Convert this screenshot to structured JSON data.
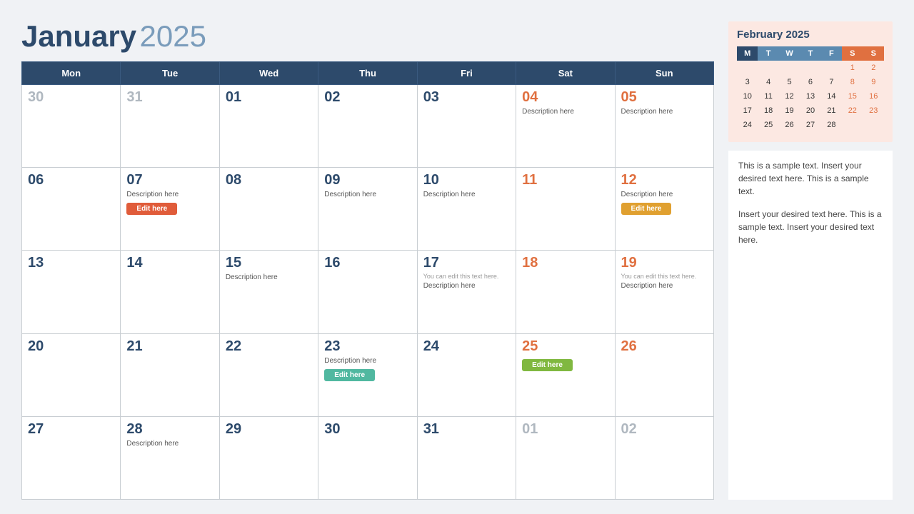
{
  "header": {
    "month": "January",
    "year": "2025"
  },
  "weekdays": [
    "Mon",
    "Tue",
    "Wed",
    "Thu",
    "Fri",
    "Sat",
    "Sun"
  ],
  "weeks": [
    [
      {
        "num": "30",
        "inactive": true
      },
      {
        "num": "31",
        "inactive": true
      },
      {
        "num": "01"
      },
      {
        "num": "02"
      },
      {
        "num": "03"
      },
      {
        "num": "04",
        "weekend": true,
        "desc": "Description here"
      },
      {
        "num": "05",
        "weekend": true,
        "desc": "Description here"
      }
    ],
    [
      {
        "num": "06"
      },
      {
        "num": "07",
        "desc": "Description here",
        "btn": "Edit here",
        "btnClass": "btn-red"
      },
      {
        "num": "08"
      },
      {
        "num": "09",
        "desc": "Description here"
      },
      {
        "num": "10",
        "desc": "Description here"
      },
      {
        "num": "11",
        "weekend": true
      },
      {
        "num": "12",
        "weekend": true,
        "desc": "Description here",
        "btn": "Edit here",
        "btnClass": "btn-orange"
      }
    ],
    [
      {
        "num": "13"
      },
      {
        "num": "14"
      },
      {
        "num": "15",
        "desc": "Description here"
      },
      {
        "num": "16"
      },
      {
        "num": "17",
        "note": "You can edit this text here.",
        "desc": "Description here"
      },
      {
        "num": "18",
        "weekend": true
      },
      {
        "num": "19",
        "weekend": true,
        "note": "You can edit this text here.",
        "desc": "Description here"
      }
    ],
    [
      {
        "num": "20"
      },
      {
        "num": "21"
      },
      {
        "num": "22"
      },
      {
        "num": "23",
        "desc": "Description here",
        "btn": "Edit here",
        "btnClass": "btn-teal"
      },
      {
        "num": "24"
      },
      {
        "num": "25",
        "weekend": true,
        "btn": "Edit here",
        "btnClass": "btn-green"
      },
      {
        "num": "26",
        "weekend": true
      }
    ],
    [
      {
        "num": "27"
      },
      {
        "num": "28",
        "desc": "Description here"
      },
      {
        "num": "29"
      },
      {
        "num": "30"
      },
      {
        "num": "31"
      },
      {
        "num": "01",
        "inactive": true
      },
      {
        "num": "02",
        "inactive": true
      }
    ]
  ],
  "miniCal": {
    "title": "February 2025",
    "headers": [
      "M",
      "T",
      "W",
      "T",
      "F",
      "S",
      "S"
    ],
    "rows": [
      [
        "",
        "",
        "",
        "",
        "",
        "1",
        "2"
      ],
      [
        "3",
        "4",
        "5",
        "6",
        "7",
        "8",
        "9"
      ],
      [
        "10",
        "11",
        "12",
        "13",
        "14",
        "15",
        "16"
      ],
      [
        "17",
        "18",
        "19",
        "20",
        "21",
        "22",
        "23"
      ],
      [
        "24",
        "25",
        "26",
        "27",
        "28",
        "",
        ""
      ]
    ]
  },
  "notes": {
    "text1": "This is a sample text. Insert your desired text here. This is a sample text.",
    "text2": "Insert your desired text here. This is a sample text. Insert your desired text here."
  },
  "buttons": {
    "edit": "Edit here"
  }
}
